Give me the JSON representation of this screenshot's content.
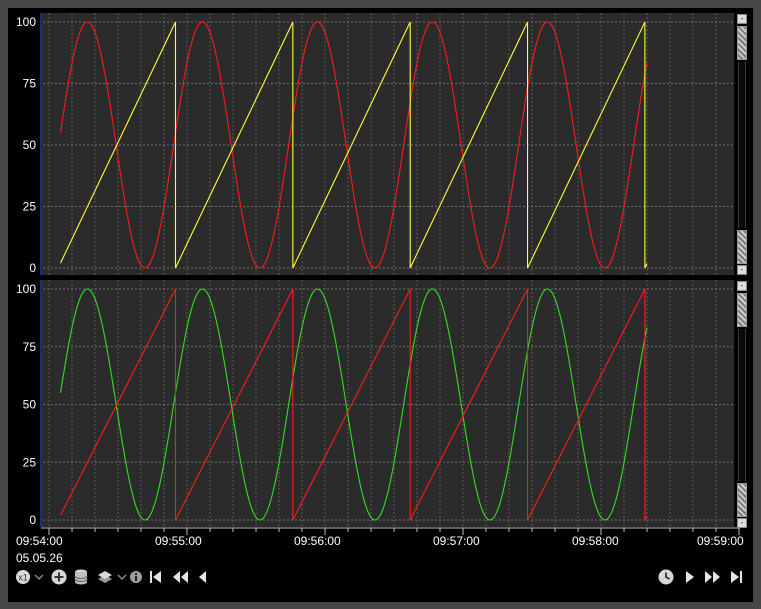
{
  "colors": {
    "background": "#000000",
    "plot_background": "#2b2b2b",
    "grid": "#6c6c6c",
    "axis_text": "#ffffff",
    "yellow": "#ffff33",
    "red": "#ff1a1a",
    "green": "#33dd22"
  },
  "chart_data": [
    {
      "type": "line",
      "ylim": [
        0,
        100
      ],
      "yticks": [
        "100",
        "75",
        "50",
        "25",
        "0"
      ],
      "xlim": [
        "09:54:00",
        "09:59:00"
      ],
      "grid": true,
      "series": [
        {
          "color": "#ff1a1a",
          "shape": "sine",
          "period_s": 50,
          "start_value": 55,
          "x_start": "09:54:05",
          "x_end": "09:58:20"
        },
        {
          "color": "#ffff33",
          "shape": "sawtooth",
          "period_s": 50,
          "start_value": 2,
          "peak_value": 100,
          "x_start": "09:54:05",
          "x_end": "09:58:20"
        }
      ]
    },
    {
      "type": "line",
      "ylim": [
        0,
        100
      ],
      "yticks": [
        "100",
        "75",
        "50",
        "25",
        "0"
      ],
      "xlim": [
        "09:54:00",
        "09:59:00"
      ],
      "grid": true,
      "series": [
        {
          "color": "#33dd22",
          "shape": "sine",
          "period_s": 50,
          "start_value": 55,
          "x_start": "09:54:05",
          "x_end": "09:58:20"
        },
        {
          "color": "#ff1a1a",
          "shape": "sawtooth",
          "period_s": 50,
          "start_value": 2,
          "peak_value": 100,
          "x_start": "09:54:05",
          "x_end": "09:58:20"
        }
      ]
    }
  ],
  "x_axis": {
    "labels": [
      "09:54:00",
      "09:55:00",
      "09:56:00",
      "09:57:00",
      "09:58:00",
      "09:59:00"
    ],
    "date": "05.05.26"
  },
  "scrollbar": {
    "top_button": "-",
    "bottom_button": "-"
  },
  "toolbar": {
    "left_icons": [
      "zoom-reset-icon",
      "zoom-in-icon",
      "database-icon",
      "layers-icon",
      "info-icon",
      "skip-to-start-icon",
      "fast-rewind-icon",
      "step-back-icon"
    ],
    "right_icons": [
      "clock-icon",
      "play-icon",
      "fast-forward-icon",
      "skip-to-end-icon"
    ]
  }
}
